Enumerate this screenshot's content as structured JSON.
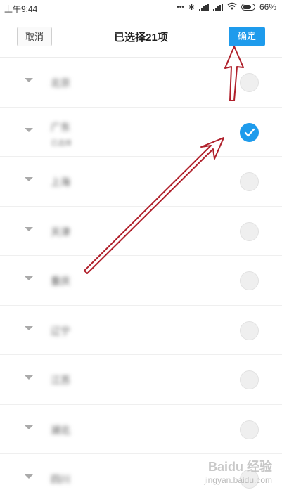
{
  "status_bar": {
    "time": "上午9:44",
    "battery": "66%"
  },
  "header": {
    "cancel_label": "取消",
    "title": "已选择21项",
    "confirm_label": "确定"
  },
  "list": {
    "items": [
      {
        "label": "北京",
        "sub": "",
        "checked": false
      },
      {
        "label": "广东",
        "sub": "已选择",
        "checked": true
      },
      {
        "label": "上海",
        "sub": "",
        "checked": false
      },
      {
        "label": "天津",
        "sub": "",
        "checked": false
      },
      {
        "label": "重庆",
        "sub": "",
        "checked": false
      },
      {
        "label": "辽宁",
        "sub": "",
        "checked": false
      },
      {
        "label": "江苏",
        "sub": "",
        "checked": false
      },
      {
        "label": "湖北",
        "sub": "",
        "checked": false
      },
      {
        "label": "四川",
        "sub": "",
        "checked": false
      }
    ]
  },
  "watermark": {
    "brand": "Baidu 经验",
    "url": "jingyan.baidu.com"
  },
  "colors": {
    "accent": "#1e9bec",
    "annotation": "#b0202b"
  }
}
